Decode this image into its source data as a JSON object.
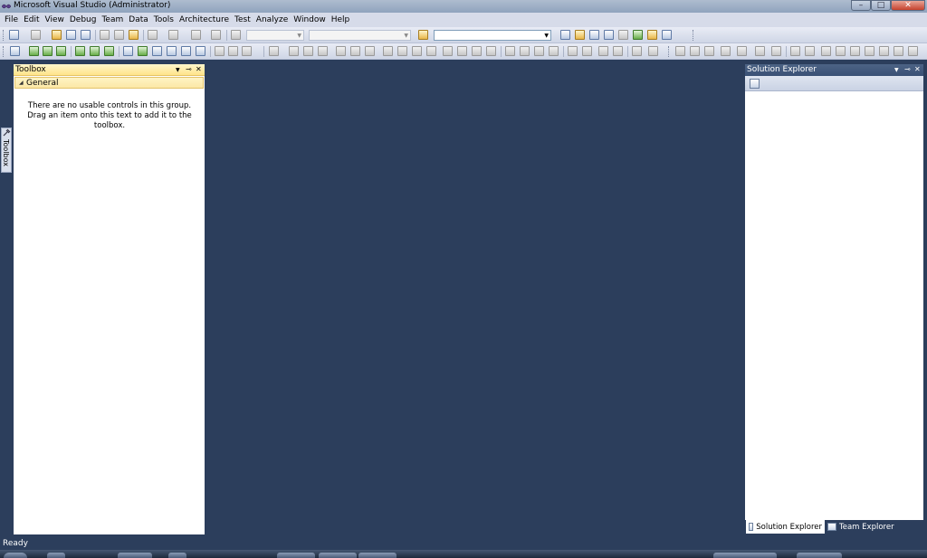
{
  "window": {
    "title": "Microsoft Visual Studio (Administrator)",
    "controls": {
      "minimize": "–",
      "maximize": "□",
      "close": "✕"
    }
  },
  "menu": [
    "File",
    "Edit",
    "View",
    "Debug",
    "Team",
    "Data",
    "Tools",
    "Architecture",
    "Test",
    "Analyze",
    "Window",
    "Help"
  ],
  "toolbox": {
    "tab_label": "Toolbox",
    "title": "Toolbox",
    "header_buttons": {
      "dropdown": "▼",
      "pin": "⊸",
      "close": "✕"
    },
    "group": "General",
    "empty_message": "There are no usable controls in this group. Drag an item onto this text to add it to the toolbox."
  },
  "solution_explorer": {
    "title": "Solution Explorer",
    "header_buttons": {
      "dropdown": "▼",
      "pin": "⊸",
      "close": "✕"
    },
    "tabs": [
      {
        "label": "Solution Explorer",
        "active": true
      },
      {
        "label": "Team Explorer",
        "active": false
      }
    ]
  },
  "status": {
    "text": "Ready"
  },
  "colors": {
    "background": "#2c3e5c",
    "toolbox_header": "#ffe48a"
  }
}
